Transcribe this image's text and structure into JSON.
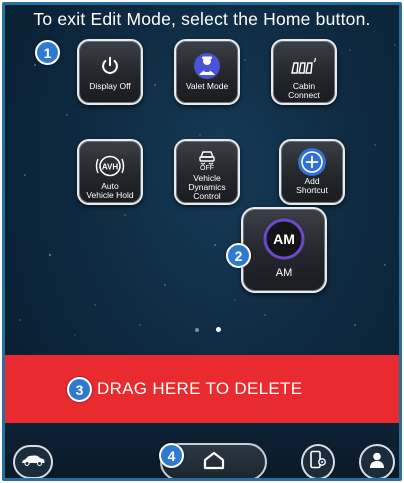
{
  "instruction": "To exit Edit Mode, select the Home button.",
  "markers": [
    "1",
    "2",
    "3",
    "4"
  ],
  "tiles": [
    {
      "label": "Display Off",
      "icon": "power-icon"
    },
    {
      "label": "Valet Mode",
      "icon": "valet-icon"
    },
    {
      "label": "Cabin\nConnect",
      "icon": "cabin-connect-icon"
    },
    {
      "label": "Auto\nVehicle Hold",
      "icon": "avh-icon"
    },
    {
      "label": "Vehicle\nDynamics\nControl",
      "icon": "vdc-off-icon",
      "icon_text": "OFF"
    },
    {
      "label": "Add\nShortcut",
      "icon": "add-circle-icon"
    }
  ],
  "dragged_tile": {
    "label": "AM",
    "badge": "AM",
    "icon": "am-radio-icon"
  },
  "avh_badge": "AVH",
  "page_dots": {
    "count": 2,
    "active": 2
  },
  "delete_zone": {
    "label": "DRAG HERE TO DELETE",
    "color": "#e92a2f"
  },
  "bottom_bar": {
    "left_icon": "car-icon",
    "home_icon": "home-icon",
    "phone_settings_icon": "phone-settings-icon",
    "profile_icon": "profile-icon"
  },
  "colors": {
    "background": "#0e2a41",
    "marker": "#2f7ad1",
    "valet_accent": "#4a52d8",
    "add_accent": "#2f6fd6",
    "am_ring": "#6a4ac8",
    "frame_border": "#2a6f9c"
  }
}
